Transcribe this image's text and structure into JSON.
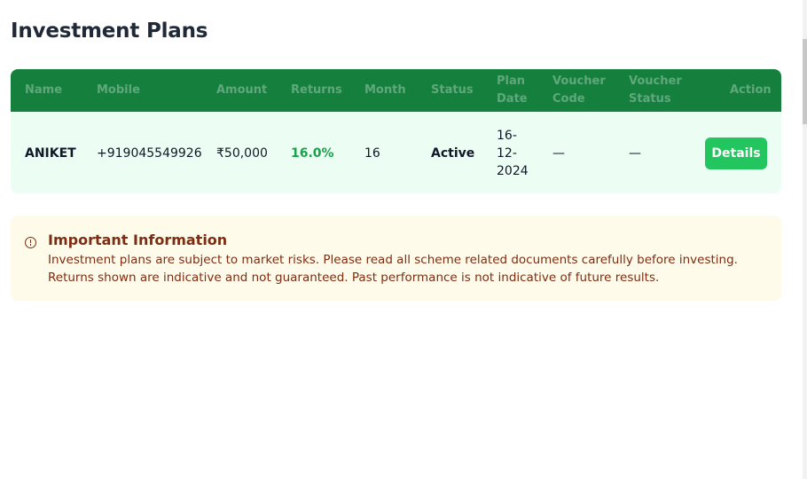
{
  "page": {
    "title": "Investment Plans"
  },
  "table": {
    "columns": {
      "name": "Name",
      "mobile": "Mobile",
      "amount": "Amount",
      "returns": "Returns",
      "month": "Month",
      "status": "Status",
      "plan_date_1": "Plan",
      "plan_date_2": "Date",
      "voucher_code_1": "Voucher",
      "voucher_code_2": "Code",
      "voucher_status_1": "Voucher",
      "voucher_status_2": "Status",
      "action": "Action"
    },
    "row": {
      "name": "ANIKET",
      "mobile": "+919045549926",
      "amount": "₹50,000",
      "returns": "16.0%",
      "month": "16",
      "status": "Active",
      "plan_date_1": "16-",
      "plan_date_2": "12-",
      "plan_date_3": "2024",
      "voucher_code": "—",
      "voucher_status": "—",
      "action_label": "Details"
    }
  },
  "info": {
    "icon": "info-circle-icon",
    "title": "Important Information",
    "text": "Investment plans are subject to market risks. Please read all scheme related documents carefully before investing. Returns shown are indicative and not guaranteed. Past performance is not indicative of future results."
  },
  "colors": {
    "header_green": "#15803d",
    "row_bg": "#ecfdf3",
    "returns_green": "#16a34a",
    "button_green": "#22c55e",
    "info_bg": "#fefbeb",
    "info_text": "#7c2d12"
  }
}
